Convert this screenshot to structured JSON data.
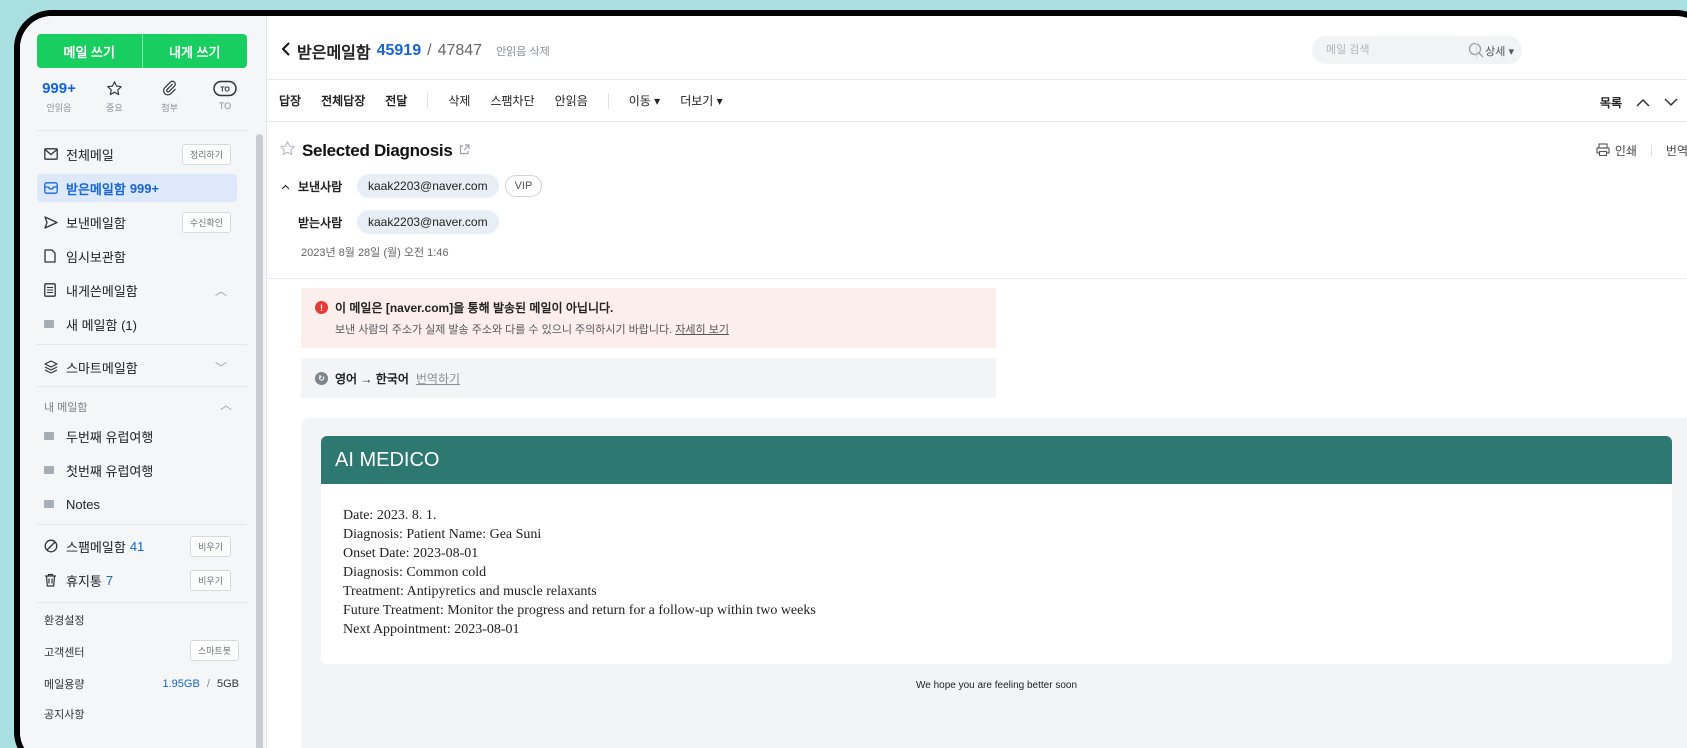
{
  "sidebar": {
    "compose_label": "메일 쓰기",
    "self_compose_label": "내게 쓰기",
    "quick": [
      {
        "top": "999+",
        "label": "안읽음"
      },
      {
        "top": "",
        "label": "중요"
      },
      {
        "top": "",
        "label": "첨부"
      },
      {
        "top": "",
        "label": "TO"
      }
    ],
    "to_badge": "TO",
    "items": {
      "all": {
        "label": "전체메일",
        "pill": "정리하기"
      },
      "inbox": {
        "label": "받은메일함",
        "count": "999+"
      },
      "sent": {
        "label": "보낸메일함",
        "pill": "수신확인"
      },
      "drafts": {
        "label": "임시보관함"
      },
      "self": {
        "label": "내게쓴메일함"
      },
      "new_folder": {
        "label": "새 메일함 (1)"
      },
      "smart": {
        "label": "스마트메일함"
      },
      "my_section": "내 메일함",
      "folder1": {
        "label": "두번째 유럽여행"
      },
      "folder2": {
        "label": "첫번째 유럽여행"
      },
      "folder3": {
        "label": "Notes"
      },
      "spam": {
        "label": "스팸메일함",
        "count": "41",
        "pill": "비우기"
      },
      "trash": {
        "label": "휴지통",
        "count": "7",
        "pill": "비우기"
      }
    },
    "settings": "환경설정",
    "support": {
      "label": "고객센터",
      "pill": "스마트봇"
    },
    "storage": {
      "label": "메일용량",
      "used": "1.95GB",
      "sep": "/",
      "total": "5GB"
    },
    "notice": "공지사항"
  },
  "header": {
    "folder": "받은메일함",
    "unread": "45919",
    "slash": "/",
    "total": "47847",
    "delete_unread": "안읽음 삭제",
    "search_placeholder": "메일 검색",
    "detail": "상세 ▾"
  },
  "toolbar": {
    "reply": "답장",
    "reply_all": "전체답장",
    "forward": "전달",
    "delete": "삭제",
    "block": "스팸차단",
    "unread": "안읽음",
    "move": "이동 ▾",
    "more": "더보기 ▾",
    "list": "목록"
  },
  "message": {
    "subject": "Selected Diagnosis",
    "print": "인쇄",
    "translate": "번역",
    "from_label": "보낸사람",
    "from": "kaak2203@naver.com",
    "vip": "VIP",
    "to_label": "받는사람",
    "to": "kaak2203@naver.com",
    "date": "2023년 8월 28일 (월) 오전 1:46",
    "warning_title": "이 메일은 [naver.com]을 통해 발송된 메일이 아닙니다.",
    "warning_desc": "보낸 사람의 주소가 실제 발송 주소와 다를 수 있으니 주의하시기 바랍니다.",
    "warning_link": "자세히 보기",
    "translate_label": "영어 → 한국어",
    "translate_link": "번역하기",
    "card_title": "AI MEDICO",
    "lines": [
      "Date: 2023. 8. 1.",
      "Diagnosis: Patient Name: Gea Suni",
      "Onset Date: 2023-08-01",
      "Diagnosis: Common cold",
      "Treatment: Antipyretics and muscle relaxants",
      "Future Treatment: Monitor the progress and return for a follow-up within two weeks",
      "Next Appointment: 2023-08-01"
    ],
    "closing": "We hope you are feeling better soon"
  },
  "colors": {
    "compose_green": "#19ce60",
    "accent_blue": "#1565d8",
    "card_header": "#2e7872",
    "background": "#a9dfe0"
  }
}
